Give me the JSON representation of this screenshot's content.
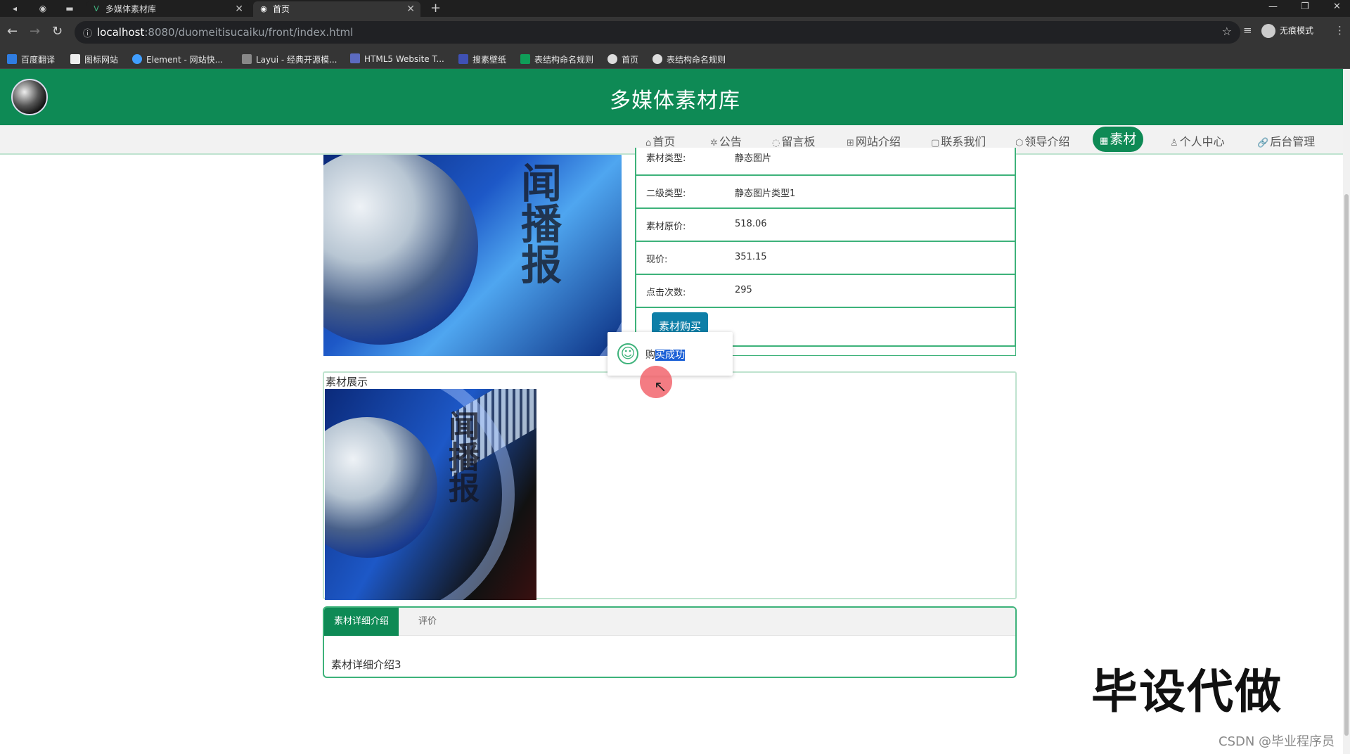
{
  "browser": {
    "tabs": [
      {
        "label": "多媒体素材库",
        "active": false
      },
      {
        "label": "首页",
        "active": true
      }
    ],
    "url_host": "localhost",
    "url_rest": ":8080/duomeitisucaiku/front/index.html",
    "incognito_label": "无痕模式",
    "bookmarks": [
      "百度翻译",
      "图标网站",
      "Element - 网站快...",
      "Layui - 经典开源模...",
      "HTML5 Website T...",
      "搜素壁纸",
      "表结构命名规则",
      "首页",
      "表结构命名规则"
    ]
  },
  "site": {
    "title": "多媒体素材库",
    "nav": [
      {
        "label": "首页",
        "icon": "home-icon",
        "active": false
      },
      {
        "label": "公告",
        "icon": "sparkle-icon",
        "active": false
      },
      {
        "label": "留言板",
        "icon": "message-icon",
        "active": false
      },
      {
        "label": "网站介绍",
        "icon": "grid-icon",
        "active": false
      },
      {
        "label": "联系我们",
        "icon": "contact-icon",
        "active": false
      },
      {
        "label": "领导介绍",
        "icon": "cube-icon",
        "active": false
      },
      {
        "label": "素材",
        "icon": "image-icon",
        "active": true
      },
      {
        "label": "个人中心",
        "icon": "user-icon",
        "active": false
      },
      {
        "label": "后台管理",
        "icon": "link-icon",
        "active": false
      }
    ]
  },
  "material": {
    "image_text": "闻播报",
    "rows": [
      {
        "label": "素材类型:",
        "value": "静态图片"
      },
      {
        "label": "二级类型:",
        "value": "静态图片类型1"
      },
      {
        "label": "素材原价:",
        "value": "518.06"
      },
      {
        "label": "现价:",
        "value": "351.15"
      },
      {
        "label": "点击次数:",
        "value": "295"
      }
    ],
    "buy_label": "素材购买",
    "showcase_label": "素材展示",
    "tabs": [
      "素材详细介绍",
      "评价"
    ],
    "detail_text": "素材详细介绍3"
  },
  "toast": {
    "prefix": "购",
    "selected": "买成功"
  },
  "watermark": {
    "big": "毕设代做",
    "small": "CSDN @毕业程序员"
  },
  "colors": {
    "brand_green": "#0e8a55",
    "buy_blue": "#0e7fa8",
    "border_green": "#3db27a"
  }
}
